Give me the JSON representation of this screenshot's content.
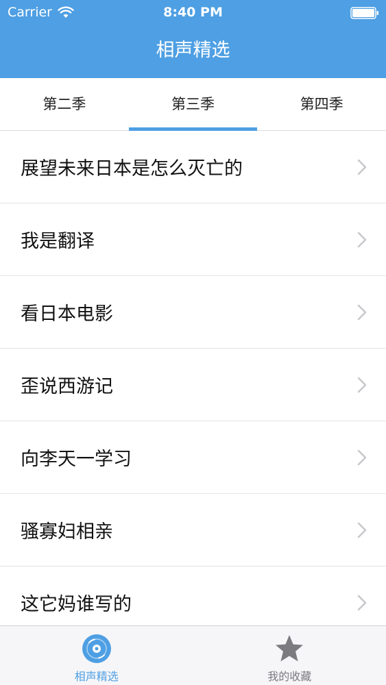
{
  "status_bar": {
    "carrier": "Carrier",
    "time": "8:40 PM"
  },
  "nav": {
    "title": "相声精选"
  },
  "tabs": [
    {
      "label": "第二季",
      "active": false
    },
    {
      "label": "第三季",
      "active": true
    },
    {
      "label": "第四季",
      "active": false
    }
  ],
  "episodes": [
    {
      "title": "展望未来日本是怎么灭亡的"
    },
    {
      "title": "我是翻译"
    },
    {
      "title": "看日本电影"
    },
    {
      "title": "歪说西游记"
    },
    {
      "title": "向李天一学习"
    },
    {
      "title": "骚寡妇相亲"
    },
    {
      "title": "这它妈谁写的"
    }
  ],
  "tabbar": {
    "items": [
      {
        "label": "相声精选",
        "icon": "disc-icon",
        "active": true
      },
      {
        "label": "我的收藏",
        "icon": "star-icon",
        "active": false
      }
    ]
  },
  "colors": {
    "accent": "#4e9fe3",
    "inactive_icon": "#7b7b80",
    "inactive_label": "#7b7b80"
  }
}
